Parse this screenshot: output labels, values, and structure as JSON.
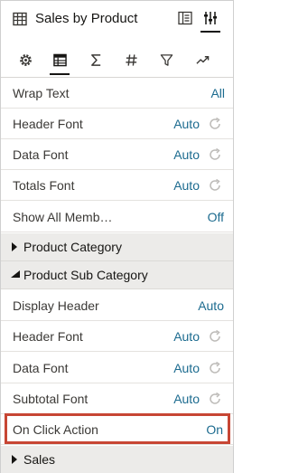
{
  "header": {
    "title": "Sales by Product",
    "icons": [
      "table-icon",
      "grammar-panel-icon",
      "properties-panel-icon"
    ]
  },
  "tabs": [
    {
      "name": "general-tab",
      "icon": "gear-icon"
    },
    {
      "name": "table-tab",
      "icon": "table-icon"
    },
    {
      "name": "totals-tab",
      "icon": "sigma-icon"
    },
    {
      "name": "number-format-tab",
      "icon": "hash-icon"
    },
    {
      "name": "filter-tab",
      "icon": "filter-icon"
    },
    {
      "name": "analytics-tab",
      "icon": "trend-icon"
    }
  ],
  "rows_top": [
    {
      "label": "Wrap Text",
      "value": "All"
    },
    {
      "label": "Header Font",
      "value": "Auto"
    },
    {
      "label": "Data Font",
      "value": "Auto"
    },
    {
      "label": "Totals Font",
      "value": "Auto"
    },
    {
      "label": "Show All Memb…",
      "value": "Off"
    }
  ],
  "sections": {
    "product_category": "Product Category",
    "product_sub_category": "Product Sub Category",
    "sales": "Sales"
  },
  "rows_sub": [
    {
      "label": "Display Header",
      "value": "Auto"
    },
    {
      "label": "Header Font",
      "value": "Auto"
    },
    {
      "label": "Data Font",
      "value": "Auto"
    },
    {
      "label": "Subtotal Font",
      "value": "Auto"
    },
    {
      "label": "On Click Action",
      "value": "On"
    }
  ],
  "colors": {
    "value_text": "#1c6b8f",
    "highlight_border": "#c74634",
    "section_bg": "#ecebe9"
  }
}
